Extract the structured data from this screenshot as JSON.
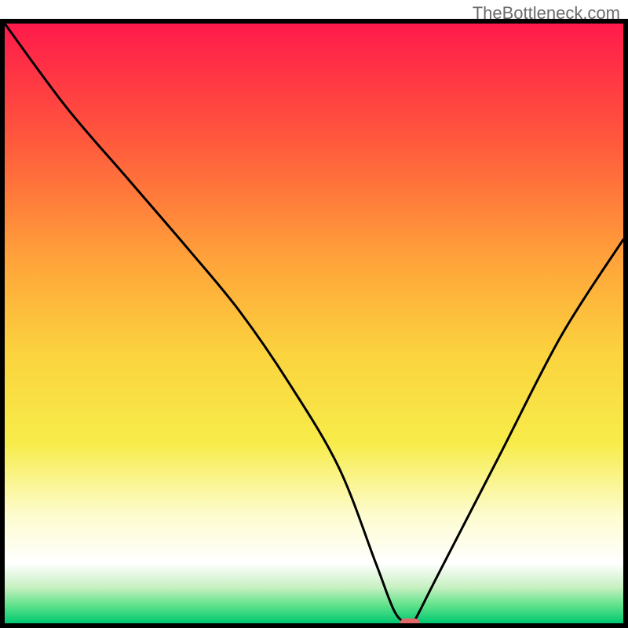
{
  "attribution": "TheBottleneck.com",
  "chart_data": {
    "type": "line",
    "title": "",
    "xlabel": "",
    "ylabel": "",
    "xlim": [
      0,
      100
    ],
    "ylim": [
      0,
      100
    ],
    "grid": false,
    "legend": false,
    "gradient_stops": [
      {
        "y_pct": 0,
        "color": "#ff1a4b"
      },
      {
        "y_pct": 20,
        "color": "#ff5a3c"
      },
      {
        "y_pct": 40,
        "color": "#ffa53a"
      },
      {
        "y_pct": 55,
        "color": "#fbd33e"
      },
      {
        "y_pct": 70,
        "color": "#f7ec4a"
      },
      {
        "y_pct": 82,
        "color": "#fdfccf"
      },
      {
        "y_pct": 90,
        "color": "#ffffff"
      },
      {
        "y_pct": 94,
        "color": "#c7f0c1"
      },
      {
        "y_pct": 97,
        "color": "#5fe28a"
      },
      {
        "y_pct": 100,
        "color": "#00c871"
      }
    ],
    "series": [
      {
        "name": "bottleneck-curve",
        "style": "solid-black",
        "x": [
          0,
          10,
          20,
          30,
          38,
          46,
          54,
          60,
          63,
          65,
          66,
          70,
          80,
          90,
          100
        ],
        "y": [
          100,
          86,
          74,
          62,
          52,
          40,
          26,
          10,
          2,
          0,
          0,
          8,
          28,
          48,
          64
        ]
      }
    ],
    "marker": {
      "shape": "rounded-rect",
      "x": 65.5,
      "y": 0,
      "width_pct": 3.2,
      "height_pct": 1.6,
      "fill": "#e2686b"
    }
  }
}
